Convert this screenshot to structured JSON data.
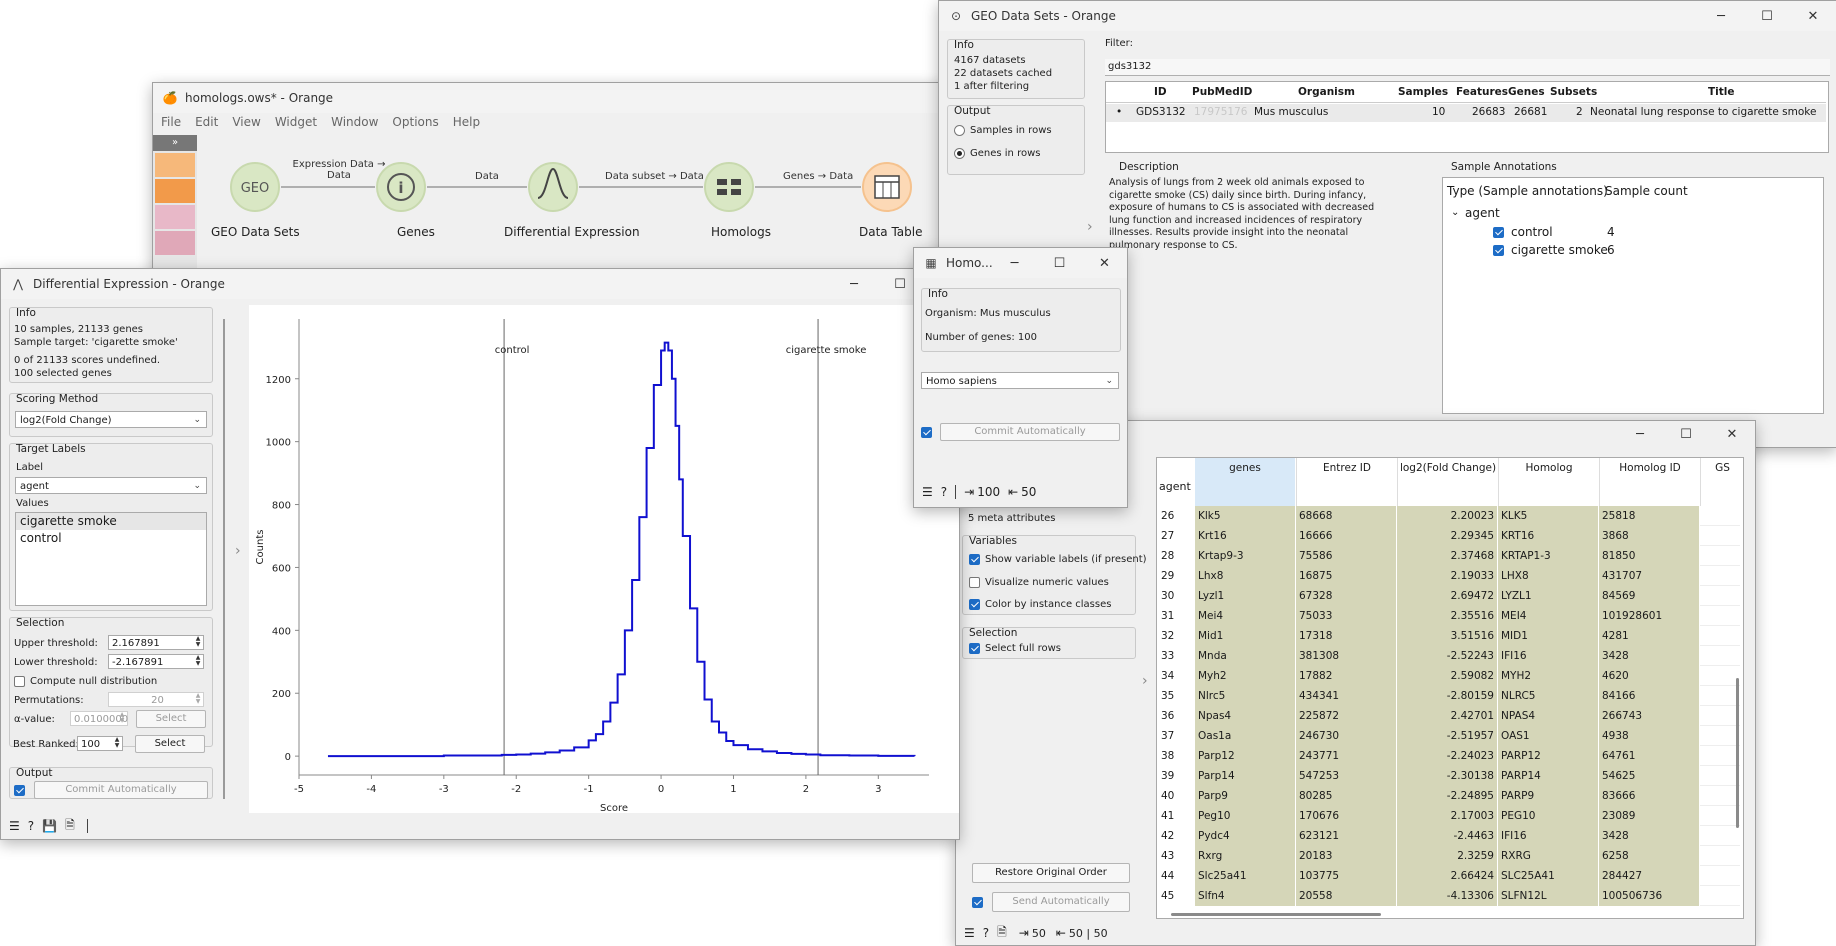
{
  "orange_main": {
    "title": "homologs.ows* - Orange",
    "menu": [
      "File",
      "Edit",
      "View",
      "Widget",
      "Window",
      "Options",
      "Help"
    ],
    "nodes": [
      {
        "label": "GEO Data Sets",
        "icon": "GEO",
        "color": "#d9e7c4"
      },
      {
        "label": "Genes",
        "icon": "ℹ",
        "color": "#d9e7c4"
      },
      {
        "label": "Differential Expression",
        "icon": "bell",
        "color": "#d9e7c4"
      },
      {
        "label": "Homologs",
        "icon": "hom",
        "color": "#d9e7c4"
      },
      {
        "label": "Data Table",
        "icon": "table",
        "color": "#fcd9b6"
      }
    ],
    "links": [
      "Expression Data → Data",
      "Data",
      "Data subset → Data",
      "Genes → Data"
    ]
  },
  "geo": {
    "title": "GEO Data Sets - Orange",
    "info_title": "Info",
    "info": [
      "4167 datasets",
      "22 datasets cached",
      "1 after filtering"
    ],
    "output_title": "Output",
    "output_options": [
      "Samples in rows",
      "Genes in rows"
    ],
    "output_selected": 1,
    "filter_label": "Filter:",
    "filter_value": "gds3132",
    "columns": [
      "ID",
      "PubMedID",
      "Organism",
      "Samples",
      "Features",
      "Genes",
      "Subsets",
      "Title"
    ],
    "row": {
      "id": "GDS3132",
      "pubmed": "17975176",
      "organism": "Mus musculus",
      "samples": "10",
      "features": "26683",
      "genes": "26681",
      "subsets": "2",
      "title": "Neonatal lung response to cigarette smoke"
    },
    "desc_title": "Description",
    "description": "Analysis of lungs from 2 week old animals exposed to cigarette smoke (CS) daily since birth. During infancy, exposure of humans to CS is associated with decreased lung function and increased incidences of respiratory illnesses. Results provide insight into the neonatal pulmonary response to CS.",
    "sa_title": "Sample Annotations",
    "sa_headers": [
      "Type (Sample annotations)",
      "Sample count"
    ],
    "sa_group": "agent",
    "sa_items": [
      {
        "label": "control",
        "count": "4"
      },
      {
        "label": "cigarette smoke",
        "count": "6"
      }
    ]
  },
  "de": {
    "title": "Differential Expression - Orange",
    "info_title": "Info",
    "info": [
      "10 samples, 21133 genes",
      "Sample target: 'cigarette smoke'",
      "0 of 21133 scores undefined.",
      "100 selected genes"
    ],
    "scoring_title": "Scoring Method",
    "scoring_value": "log2(Fold Change)",
    "target_title": "Target Labels",
    "label_label": "Label",
    "label_value": "agent",
    "values_label": "Values",
    "values": [
      "cigarette smoke",
      "control"
    ],
    "selection_title": "Selection",
    "upper_label": "Upper threshold:",
    "upper_value": "2.167891",
    "lower_label": "Lower threshold:",
    "lower_value": "-2.167891",
    "null_label": "Compute null distribution",
    "perm_label": "Permutations:",
    "perm_value": "20",
    "alpha_label": "α-value:",
    "alpha_value": "0.0100000",
    "select_label": "Select",
    "best_label": "Best Ranked:",
    "best_value": "100",
    "output_title": "Output",
    "commit_label": "Commit Automatically"
  },
  "chart_data": {
    "type": "line",
    "xlabel": "Score",
    "ylabel": "Counts",
    "xlim": [
      -5,
      3.7
    ],
    "ylim": [
      -60,
      1390
    ],
    "xticks": [
      -5,
      -4,
      -3,
      -2,
      -1,
      0,
      1,
      2,
      3
    ],
    "yticks": [
      0,
      200,
      400,
      600,
      800,
      1000,
      1200
    ],
    "markers": [
      {
        "label": "control",
        "x": -2.167891
      },
      {
        "label": "cigarette smoke",
        "x": 2.167891
      }
    ],
    "series": [
      {
        "x": [
          -4.6,
          -3.0,
          -2.2,
          -2.0,
          -1.8,
          -1.6,
          -1.4,
          -1.2,
          -1.0,
          -0.9,
          -0.8,
          -0.7,
          -0.6,
          -0.5,
          -0.4,
          -0.3,
          -0.2,
          -0.1,
          0.0,
          0.05,
          0.1,
          0.15,
          0.2,
          0.25,
          0.3,
          0.4,
          0.5,
          0.6,
          0.7,
          0.8,
          0.9,
          1.0,
          1.2,
          1.4,
          1.6,
          1.8,
          2.0,
          2.2,
          2.6,
          3.0,
          3.5
        ],
        "y": [
          0,
          2,
          4,
          5,
          8,
          12,
          18,
          28,
          50,
          70,
          110,
          170,
          260,
          400,
          560,
          760,
          980,
          1180,
          1290,
          1315,
          1290,
          1200,
          1050,
          880,
          700,
          470,
          300,
          180,
          110,
          75,
          48,
          35,
          22,
          15,
          10,
          7,
          5,
          3,
          2,
          1,
          0
        ]
      }
    ]
  },
  "homo": {
    "title": "Homo...",
    "info_title": "Info",
    "organism": "Organism: Mus musculus",
    "genes": "Number of genes: 100",
    "target": "Homo sapiens",
    "commit_label": "Commit Automatically",
    "in_count": "100",
    "out_count": "50"
  },
  "dt": {
    "meta_attrs": "5 meta attributes",
    "variables_title": "Variables",
    "opt_show_labels": "Show variable labels (if present)",
    "opt_visualize": "Visualize numeric values",
    "opt_color": "Color by instance classes",
    "selection_title": "Selection",
    "opt_full_rows": "Select full rows",
    "restore_label": "Restore Original Order",
    "send_label": "Send Automatically",
    "corner": "agent",
    "columns": [
      "genes",
      "Entrez ID",
      "log2(Fold Change)",
      "Homolog",
      "Homolog ID",
      "GS"
    ],
    "rows": [
      [
        "26",
        "Klk5",
        "68668",
        "2.20023",
        "KLK5",
        "25818"
      ],
      [
        "27",
        "Krt16",
        "16666",
        "2.29345",
        "KRT16",
        "3868"
      ],
      [
        "28",
        "Krtap9-3",
        "75586",
        "2.37468",
        "KRTAP1-3",
        "81850"
      ],
      [
        "29",
        "Lhx8",
        "16875",
        "2.19033",
        "LHX8",
        "431707"
      ],
      [
        "30",
        "Lyzl1",
        "67328",
        "2.69472",
        "LYZL1",
        "84569"
      ],
      [
        "31",
        "Mei4",
        "75033",
        "2.35516",
        "MEI4",
        "101928601"
      ],
      [
        "32",
        "Mid1",
        "17318",
        "3.51516",
        "MID1",
        "4281"
      ],
      [
        "33",
        "Mnda",
        "381308",
        "-2.52243",
        "IFI16",
        "3428"
      ],
      [
        "34",
        "Myh2",
        "17882",
        "2.59082",
        "MYH2",
        "4620"
      ],
      [
        "35",
        "Nlrc5",
        "434341",
        "-2.80159",
        "NLRC5",
        "84166"
      ],
      [
        "36",
        "Npas4",
        "225872",
        "2.42701",
        "NPAS4",
        "266743"
      ],
      [
        "37",
        "Oas1a",
        "246730",
        "-2.51957",
        "OAS1",
        "4938"
      ],
      [
        "38",
        "Parp12",
        "243771",
        "-2.24023",
        "PARP12",
        "64761"
      ],
      [
        "39",
        "Parp14",
        "547253",
        "-2.30138",
        "PARP14",
        "54625"
      ],
      [
        "40",
        "Parp9",
        "80285",
        "-2.24895",
        "PARP9",
        "83666"
      ],
      [
        "41",
        "Peg10",
        "170676",
        "2.17003",
        "PEG10",
        "23089"
      ],
      [
        "42",
        "Pydc4",
        "623121",
        "-2.4463",
        "IFI16",
        "3428"
      ],
      [
        "43",
        "Rxrg",
        "20183",
        "2.3259",
        "RXRG",
        "6258"
      ],
      [
        "44",
        "Slc25a41",
        "103775",
        "2.66424",
        "SLC25A41",
        "284427"
      ],
      [
        "45",
        "Slfn4",
        "20558",
        "-4.13306",
        "SLFN12L",
        "100506736"
      ]
    ],
    "status_in": "50",
    "status_out": "50 | 50"
  }
}
